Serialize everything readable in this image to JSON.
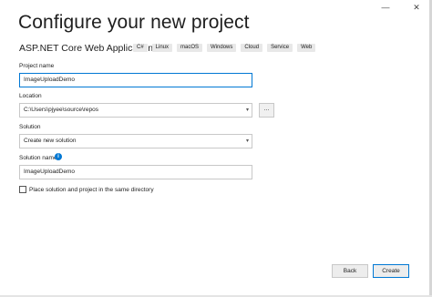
{
  "window": {
    "minimize_glyph": "—",
    "close_glyph": "✕"
  },
  "header": {
    "title": "Configure your new project",
    "template_name": "ASP.NET Core Web Application",
    "tags": [
      "C#",
      "Linux",
      "macOS",
      "Windows",
      "Cloud",
      "Service",
      "Web"
    ]
  },
  "form": {
    "project_name": {
      "label": "Project name",
      "value": "ImageUploadDemo"
    },
    "location": {
      "label": "Location",
      "value": "C:\\Users\\pjyee\\source\\repos",
      "browse_label": "..."
    },
    "solution": {
      "label": "Solution",
      "value": "Create new solution"
    },
    "solution_name": {
      "label": "Solution name",
      "value": "ImageUploadDemo",
      "info_glyph": "i"
    },
    "same_directory": {
      "label": "Place solution and project in the same directory",
      "checked": false
    }
  },
  "footer": {
    "back_label": "Back",
    "create_label": "Create"
  },
  "colors": {
    "accent": "#0078d4",
    "tag_bg": "#e8e8e8"
  }
}
